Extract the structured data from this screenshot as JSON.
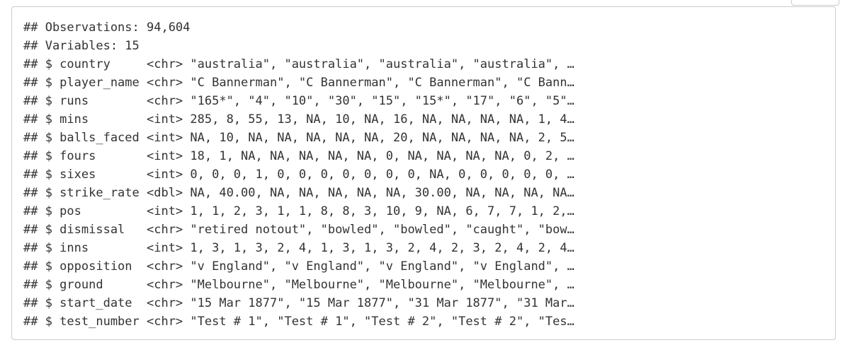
{
  "output": {
    "lines": [
      "## Observations: 94,604",
      "## Variables: 15",
      "## $ country     <chr> \"australia\", \"australia\", \"australia\", \"australia\", …",
      "## $ player_name <chr> \"C Bannerman\", \"C Bannerman\", \"C Bannerman\", \"C Bann…",
      "## $ runs        <chr> \"165*\", \"4\", \"10\", \"30\", \"15\", \"15*\", \"17\", \"6\", \"5\"…",
      "## $ mins        <int> 285, 8, 55, 13, NA, 10, NA, 16, NA, NA, NA, NA, 1, 4…",
      "## $ balls_faced <int> NA, 10, NA, NA, NA, NA, NA, 20, NA, NA, NA, NA, 2, 5…",
      "## $ fours       <int> 18, 1, NA, NA, NA, NA, NA, 0, NA, NA, NA, NA, 0, 2, …",
      "## $ sixes       <int> 0, 0, 0, 1, 0, 0, 0, 0, 0, 0, 0, NA, 0, 0, 0, 0, 0, …",
      "## $ strike_rate <dbl> NA, 40.00, NA, NA, NA, NA, NA, 30.00, NA, NA, NA, NA…",
      "## $ pos         <int> 1, 1, 2, 3, 1, 1, 8, 8, 3, 10, 9, NA, 6, 7, 7, 1, 2,…",
      "## $ dismissal   <chr> \"retired notout\", \"bowled\", \"bowled\", \"caught\", \"bow…",
      "## $ inns        <int> 1, 3, 1, 3, 2, 4, 1, 3, 1, 3, 2, 4, 2, 3, 2, 4, 2, 4…",
      "## $ opposition  <chr> \"v England\", \"v England\", \"v England\", \"v England\", …",
      "## $ ground      <chr> \"Melbourne\", \"Melbourne\", \"Melbourne\", \"Melbourne\", …",
      "## $ start_date  <chr> \"15 Mar 1877\", \"15 Mar 1877\", \"31 Mar 1877\", \"31 Mar…",
      "## $ test_number <chr> \"Test # 1\", \"Test # 1\", \"Test # 2\", \"Test # 2\", \"Tes…"
    ]
  }
}
